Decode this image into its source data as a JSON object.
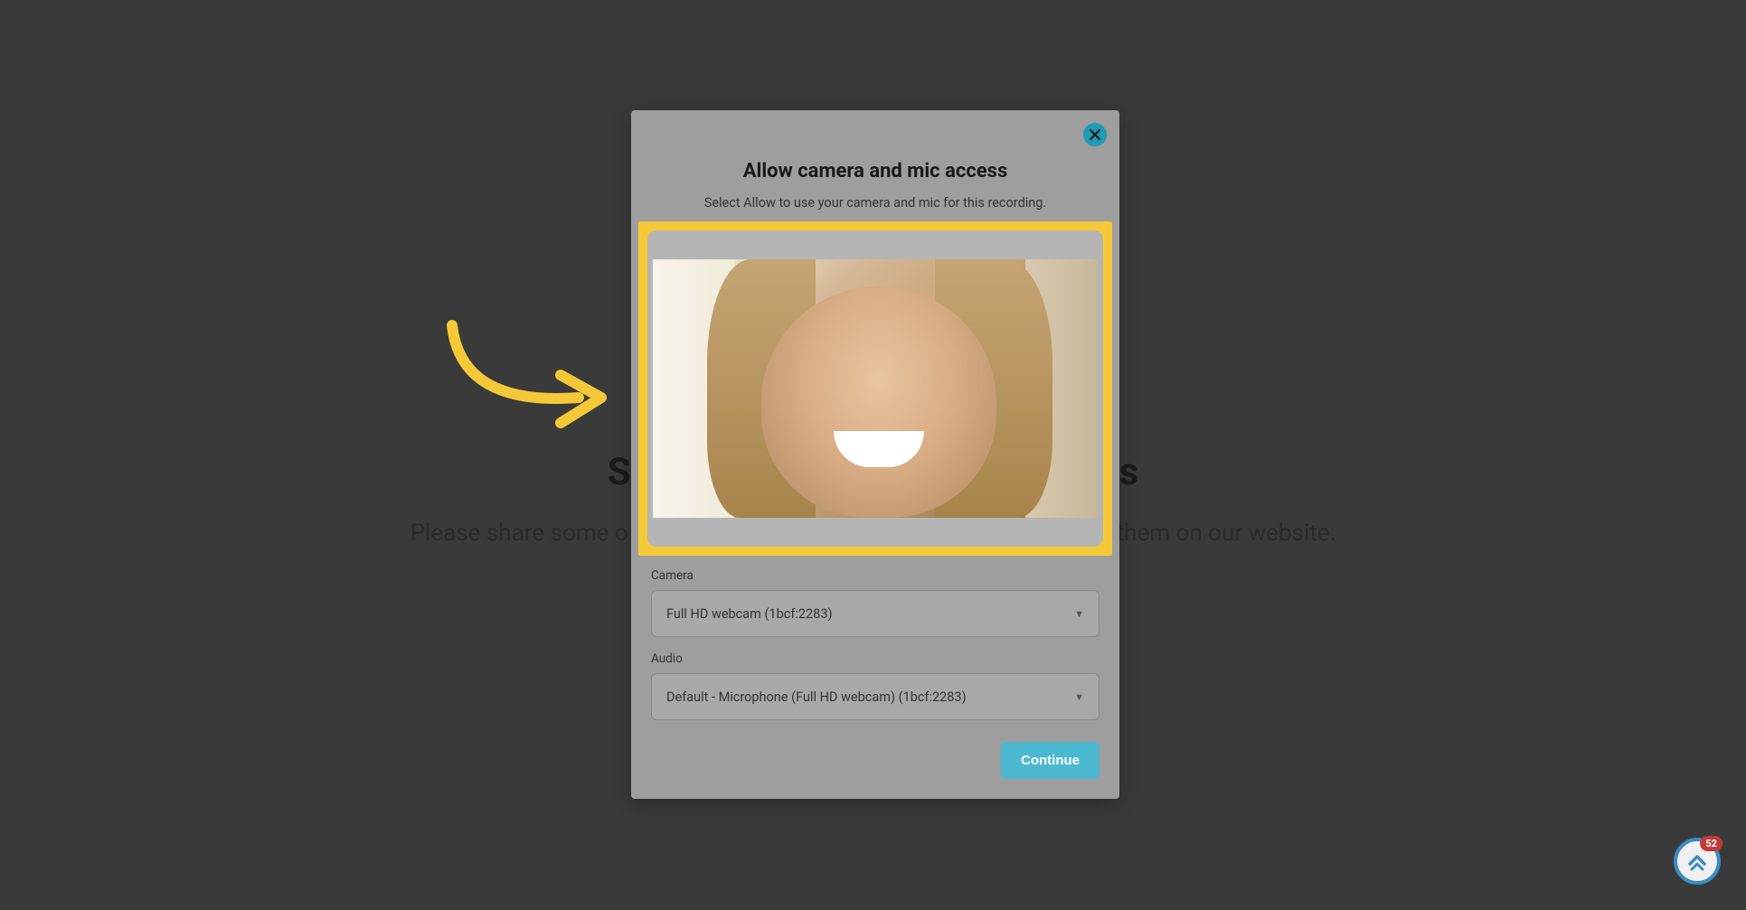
{
  "background": {
    "heading_start": "S",
    "heading_end": "s",
    "subtext_start": "Please share some o",
    "subtext_end": "them on our website."
  },
  "modal": {
    "title": "Allow camera and mic access",
    "subtitle": "Select Allow to use your camera and mic for this recording.",
    "camera_label": "Camera",
    "camera_value": "Full HD webcam (1bcf:2283)",
    "audio_label": "Audio",
    "audio_value": "Default - Microphone (Full HD webcam) (1bcf:2283)",
    "continue_label": "Continue"
  },
  "badge": {
    "count": "52"
  }
}
